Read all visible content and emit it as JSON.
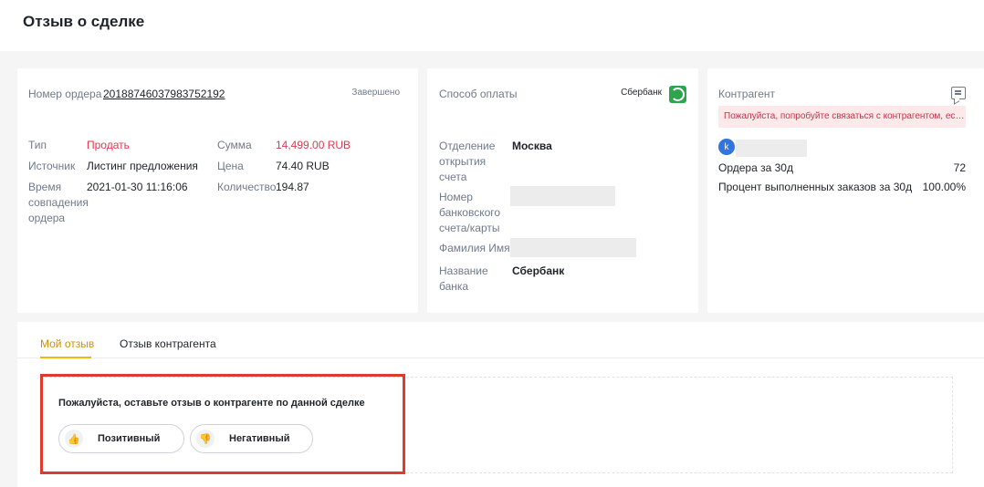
{
  "header": {
    "title": "Отзыв о сделке"
  },
  "order": {
    "number_label": "Номер ордера",
    "number_value": "20188746037983752192",
    "status": "Завершено",
    "type_label": "Тип",
    "type_value": "Продать",
    "source_label": "Источник",
    "source_value": "Листинг предложения",
    "time_label": "Время\nсовпадения\nордера",
    "time_value": "2021-01-30 11:16:06",
    "sum_label": "Сумма",
    "sum_value": "14,499.00 RUB",
    "price_label": "Цена",
    "price_value": "74.40 RUB",
    "qty_label": "Количество",
    "qty_value": "194.87"
  },
  "payment": {
    "title": "Способ оплаты",
    "bank_top": "Сбербанк",
    "branch_label": "Отделение\nоткрытия\nсчета",
    "branch_value": "Москва",
    "account_label": "Номер\nбанковского\nсчета/карты",
    "name_label": "Фамилия Имя",
    "bank_label": "Название\nбанка",
    "bank_value": "Сбербанк",
    "icon": "sberbank-icon",
    "accent": "#2ea44f"
  },
  "counterparty": {
    "title": "Контрагент",
    "warning": "Пожалуйста, попробуйте связаться с контрагентом, если у вас возникли вопросы",
    "avatar_letter": "k",
    "orders_label": "Ордера за 30д",
    "orders_value": "72",
    "completion_label": "Процент выполненных заказов за 30д",
    "completion_value": "100.00%",
    "icon": "chat-icon"
  },
  "review": {
    "tabs": [
      {
        "label": "Мой отзыв"
      },
      {
        "label": "Отзыв контрагента"
      }
    ],
    "prompt": "Пожалуйста, оставьте отзыв о контрагенте по данной сделке",
    "positive_label": "Позитивный",
    "negative_label": "Негативный",
    "accent": "#f0b90b",
    "highlight_color": "#e03a2f"
  }
}
